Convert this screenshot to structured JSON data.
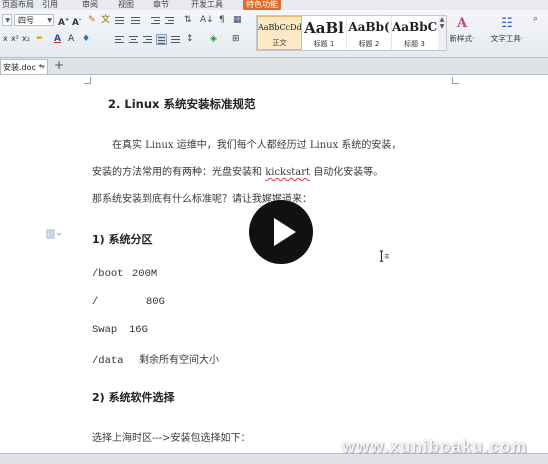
{
  "ribbon": {
    "tabs": [
      "页面布局",
      "引用",
      "审阅",
      "视图",
      "章节",
      "开发工具",
      "特色功能"
    ],
    "font_size_value": "四号",
    "style_gallery": [
      {
        "sample": "AaBbCcDd",
        "name": "正文"
      },
      {
        "sample": "AaBl",
        "name": "标题 1"
      },
      {
        "sample": "AaBb(",
        "name": "标题 2"
      },
      {
        "sample": "AaBbC",
        "name": "标题 3"
      }
    ],
    "new_style_label": "新样式·",
    "text_tools_label": "文字工具·"
  },
  "document_tabs": {
    "active_tab": "安装.doc *",
    "new_tab_symbol": "+"
  },
  "document": {
    "heading_main": "2. Linux 系统安装标准规范",
    "para_line1": "在真实 Linux 运维中，我们每个人都经历过 Linux 系统的安装，",
    "para_line2_before": "安装的方法常用的有两种：光盘安装和 ",
    "para_line2_kick": "kickstart",
    "para_line2_after": " 自动化安装等。",
    "para_line3": "那系统安装到底有什么标准呢？请让我娓娓道来：",
    "section1_heading": "1) 系统分区",
    "partitions": [
      {
        "mount": "/boot",
        "size": "200M"
      },
      {
        "mount": "/",
        "size": "80G"
      },
      {
        "mount": "Swap",
        "size": "16G"
      },
      {
        "mount": "/data",
        "size": "剩余所有空间大小"
      }
    ],
    "section2_heading": "2) 系统软件选择",
    "section2_text": "选择上海时区--->安装包选择如下："
  },
  "overlay": {
    "watermark": "www.xuniboaku.com"
  }
}
